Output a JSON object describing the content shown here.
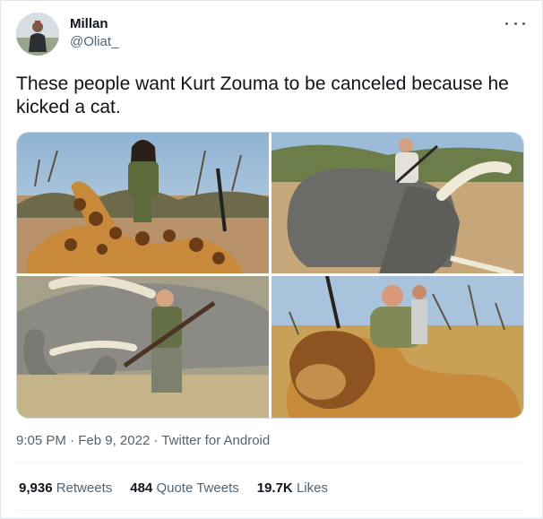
{
  "author": {
    "display_name": "Millan",
    "handle": "@Oliat_"
  },
  "tweet": {
    "text": "These people want Kurt Zouma to be canceled because he kicked a cat."
  },
  "media": [
    {
      "subject": "giraffe-hunt-photo"
    },
    {
      "subject": "elephant-hunt-photo"
    },
    {
      "subject": "elephant-hunt-photo-2"
    },
    {
      "subject": "lion-hunt-photo"
    }
  ],
  "meta": {
    "time": "9:05 PM",
    "sep1": " · ",
    "date": "Feb 9, 2022",
    "sep2": " · ",
    "source": "Twitter for Android"
  },
  "stats": {
    "retweets_count": "9,936",
    "retweets_label": "Retweets",
    "quotes_count": "484",
    "quotes_label": "Quote Tweets",
    "likes_count": "19.7K",
    "likes_label": "Likes"
  },
  "colors": {
    "text": "#0f1419",
    "secondary": "#536471",
    "border": "#cfd9de"
  },
  "icons": [
    "more-options-icon"
  ]
}
